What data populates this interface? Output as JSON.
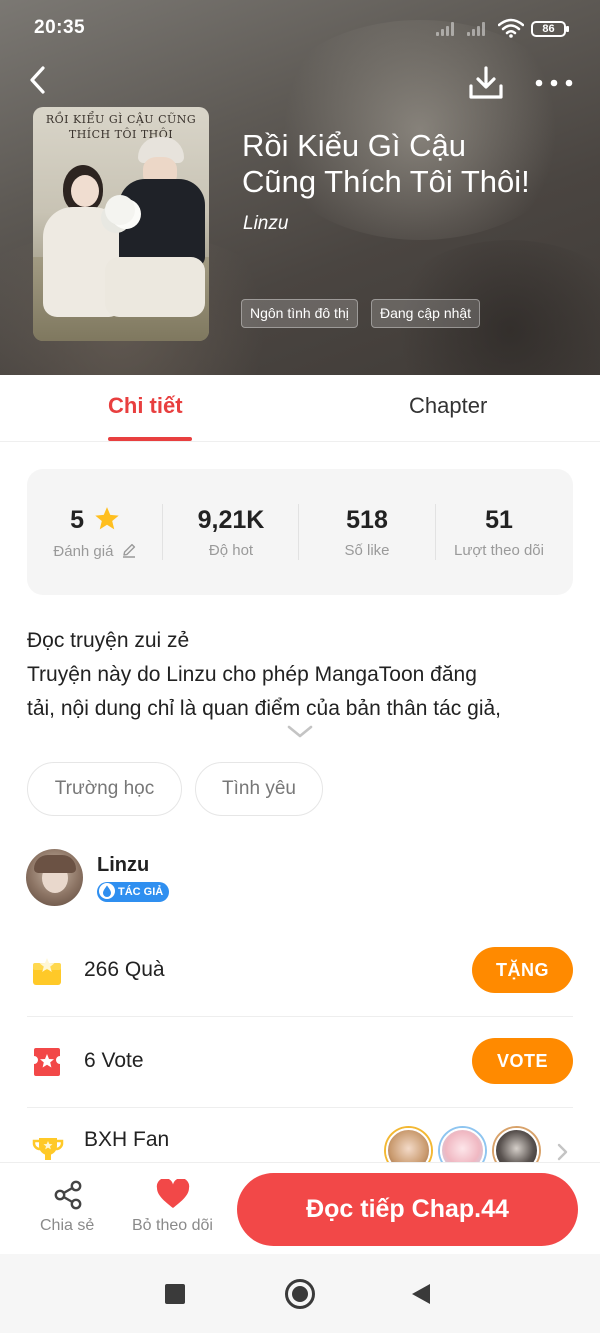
{
  "status_bar": {
    "time": "20:35",
    "battery": "86"
  },
  "book": {
    "title_line1": "Rồi Kiểu Gì Cậu",
    "title_line2": "Cũng Thích Tôi Thôi!",
    "author": "Linzu",
    "cover_text_line1": "RỒI KIỂU GÌ CẬU CŨNG",
    "cover_text_line2": "THÍCH TÔI THÔI",
    "genres": [
      "Ngôn tình đô thị",
      "Đang cập nhật"
    ]
  },
  "tabs": [
    {
      "label": "Chi tiết",
      "active": true
    },
    {
      "label": "Chapter",
      "active": false
    }
  ],
  "stats": [
    {
      "value": "5",
      "label": "Đánh giá"
    },
    {
      "value": "9,21K",
      "label": "Độ hot"
    },
    {
      "value": "518",
      "label": "Số like"
    },
    {
      "value": "51",
      "label": "Lượt theo dõi"
    }
  ],
  "description": {
    "lines": [
      "Đọc truyện zui zẻ",
      "Truyện này do Linzu cho phép MangaToon đăng",
      "tải, nội dung chỉ là quan điểm của bản thân tác giả,"
    ]
  },
  "topics": [
    "Trường học",
    "Tình yêu"
  ],
  "author_section": {
    "name": "Linzu",
    "badge": "TÁC GIẢ"
  },
  "gifts": {
    "label": "266  Quà",
    "button": "TẶNG"
  },
  "votes": {
    "label": "6  Vote",
    "button": "VOTE"
  },
  "fan_ranking": {
    "label": "BXH Fan"
  },
  "bottom_bar": {
    "share_label": "Chia sẻ",
    "unfollow_label": "Bỏ theo dõi",
    "read_button": "Đọc tiếp Chap.44"
  },
  "colors": {
    "accent_red": "#e83f3f",
    "read_button": "#f24848",
    "action_orange": "#ff8a00",
    "badge_blue": "#2f8ff0"
  }
}
